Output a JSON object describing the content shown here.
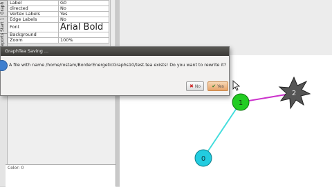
{
  "left_panel": {
    "tabs": [
      "Graph",
      "Start 1",
      "Reports"
    ],
    "properties": [
      {
        "key": "Label",
        "value": "G0"
      },
      {
        "key": "directed",
        "value": "No"
      },
      {
        "key": "Vertex Labels",
        "value": "Yes"
      },
      {
        "key": "Edge Labels",
        "value": "No"
      },
      {
        "key": "Font",
        "value": "Arial Bold"
      },
      {
        "key": "Background",
        "value": ""
      },
      {
        "key": "Zoom",
        "value": "100%"
      }
    ],
    "status_label": "Color: 0"
  },
  "dialog": {
    "title": "GraphTea Saving ...",
    "message": "A file with name /home/rostam/BorderEnergeticGraphs10/test.tea exists! Do you want to rewrite it?",
    "no_label": "No",
    "yes_label": "Yes"
  },
  "graph": {
    "vertices": [
      {
        "label": "1",
        "color": "#22cc22"
      },
      {
        "label": "2",
        "color": "#555555"
      },
      {
        "label": "0",
        "color": "#22cce0"
      }
    ],
    "edges": [
      {
        "from": "1",
        "to": "2",
        "color": "#cc33cc"
      },
      {
        "from": "1",
        "to": "0",
        "color": "#44dddd"
      }
    ]
  }
}
